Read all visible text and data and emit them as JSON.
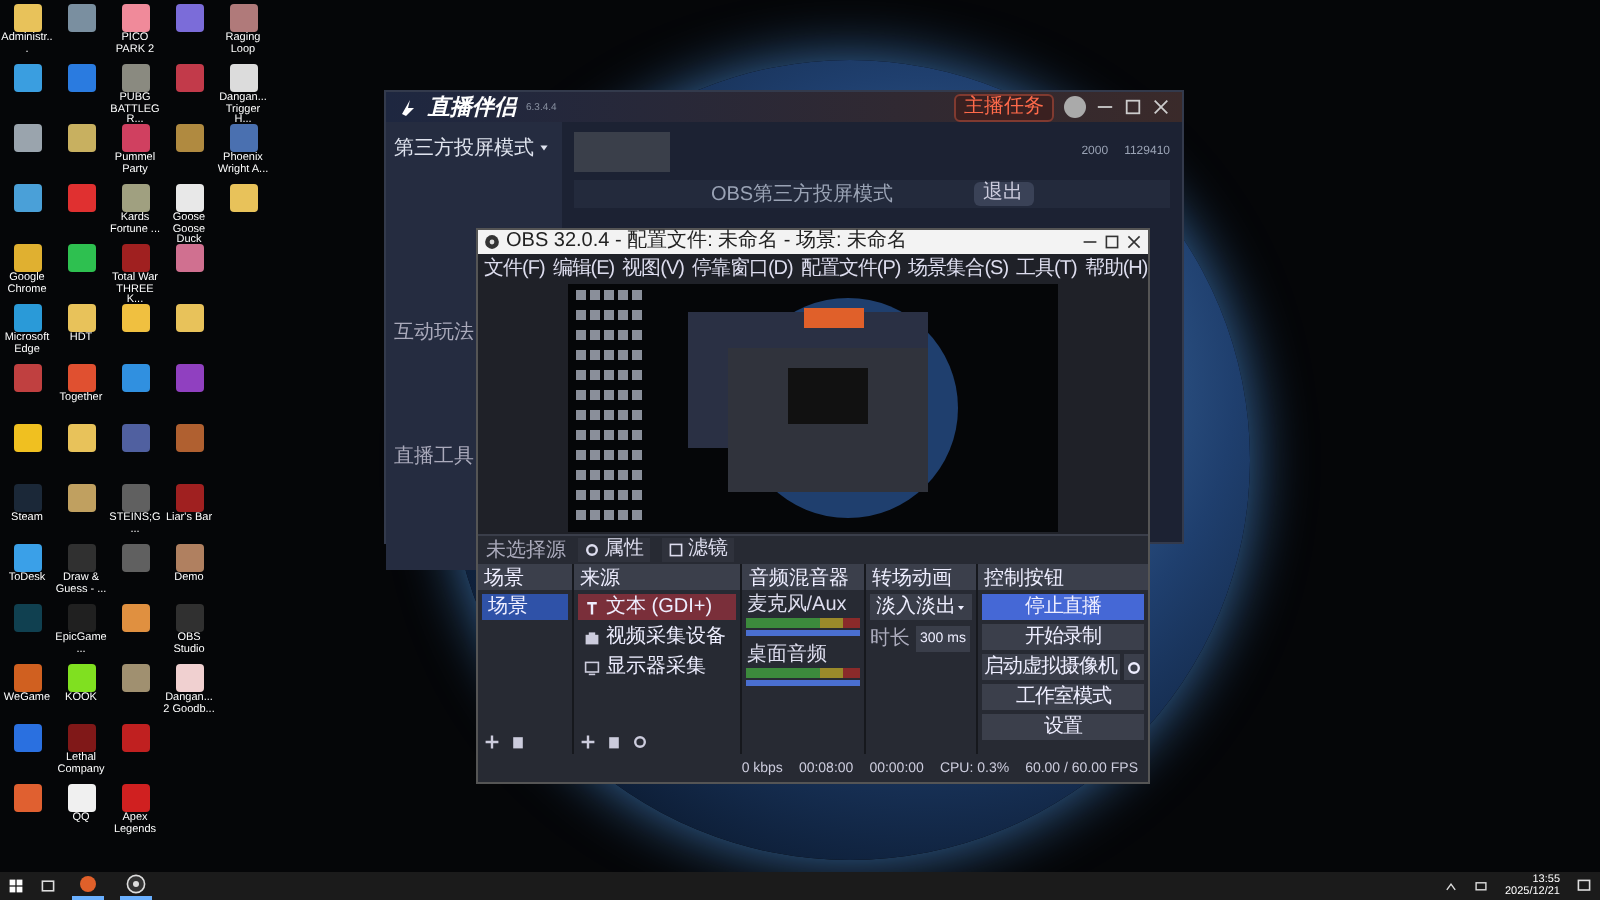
{
  "desktop": {
    "icon_rows": [
      [
        {
          "label": "Administr...",
          "color": "#e8c25a"
        },
        {
          "color": "#7a8fa0"
        },
        {
          "label": "PICO PARK 2",
          "color": "#f08a9a"
        },
        {
          "color": "#7b6cd9"
        },
        {
          "label": "Raging Loop",
          "color": "#b07a7a"
        }
      ],
      [
        {
          "color": "#3a9ee0"
        },
        {
          "color": "#2a7be0"
        },
        {
          "label": "PUBG BATTLEGR...",
          "color": "#8a8a80"
        },
        {
          "color": "#c23a4a"
        },
        {
          "label": "Dangan... Trigger H...",
          "color": "#dcdcdc"
        }
      ],
      [
        {
          "color": "#9aa4ad"
        },
        {
          "color": "#c8b060"
        },
        {
          "label": "Pummel Party",
          "color": "#d04060"
        },
        {
          "color": "#b08a40"
        },
        {
          "label": "Phoenix Wright A...",
          "color": "#4a70b0"
        }
      ],
      [
        {
          "color": "#4aa0d8"
        },
        {
          "color": "#e03030"
        },
        {
          "label": "Kards Fortune ...",
          "color": "#a0a080"
        },
        {
          "label": "Goose Goose Duck",
          "color": "#e8e8e8"
        },
        {
          "color": "#e8c25a"
        }
      ],
      [
        {
          "label": "Google Chrome",
          "color": "#e0b030"
        },
        {
          "color": "#2ec050"
        },
        {
          "label": "Total War THREE K...",
          "color": "#a02020"
        },
        {
          "color": "#d07090"
        }
      ],
      [
        {
          "label": "Microsoft Edge",
          "color": "#2a9ad8"
        },
        {
          "label": "HDT",
          "color": "#e8c25a"
        },
        {
          "color": "#f0c040"
        },
        {
          "color": "#e8c25a"
        }
      ],
      [
        {
          "color": "#c04040"
        },
        {
          "label": "Together",
          "color": "#e05030"
        },
        {
          "color": "#3090e0"
        },
        {
          "color": "#9040c0"
        }
      ],
      [
        {
          "color": "#f0c020"
        },
        {
          "color": "#e8c25a"
        },
        {
          "color": "#5060a0"
        },
        {
          "color": "#b06030"
        }
      ],
      [
        {
          "label": "Steam",
          "color": "#1b2838"
        },
        {
          "color": "#c0a060"
        },
        {
          "label": "STEINS;G...",
          "color": "#606060"
        },
        {
          "label": "Liar's Bar",
          "color": "#a02020"
        }
      ],
      [
        {
          "label": "ToDesk",
          "color": "#3aa0e8"
        },
        {
          "label": "Draw & Guess - ...",
          "color": "#303030"
        },
        {
          "color": "#606060"
        },
        {
          "label": "Demo",
          "color": "#b08060"
        }
      ],
      [
        {
          "color": "#104050"
        },
        {
          "label": "EpicGame...",
          "color": "#202020"
        },
        {
          "color": "#e09040"
        },
        {
          "label": "OBS Studio",
          "color": "#303030"
        }
      ],
      [
        {
          "label": "WeGame",
          "color": "#d06020"
        },
        {
          "label": "KOOK",
          "color": "#80e020"
        },
        {
          "color": "#a09070"
        },
        {
          "label": "Dangan... 2 Goodb...",
          "color": "#f0d0d0"
        }
      ],
      [
        {
          "color": "#2a70e0"
        },
        {
          "label": "Lethal Company",
          "color": "#801818"
        },
        {
          "color": "#c02020"
        }
      ],
      [
        {
          "color": "#e06030"
        },
        {
          "label": "QQ",
          "color": "#f0f0f0"
        },
        {
          "label": "Apex Legends",
          "color": "#d02020"
        }
      ]
    ]
  },
  "stream_app": {
    "title": "直播伴侣",
    "version": "6.3.4.4",
    "task_button": "主播任务",
    "mode": "第三方投屏模式",
    "sidebar_sections": [
      "互动玩法",
      "直播工具"
    ],
    "stats": [
      "2000",
      "1129410"
    ],
    "notice": "OBS第三方投屏模式",
    "exit_button": "退出"
  },
  "obs": {
    "title": "OBS 32.0.4 - 配置文件: 未命名 - 场景: 未命名",
    "menu": [
      "文件(F)",
      "编辑(E)",
      "视图(V)",
      "停靠窗口(D)",
      "配置文件(P)",
      "场景集合(S)",
      "工具(T)",
      "帮助(H)"
    ],
    "source_bar": {
      "label": "未选择源",
      "buttons": [
        "属性",
        "滤镜"
      ]
    },
    "scenes": {
      "title": "场景",
      "items": [
        {
          "name": "场景",
          "selected": true
        }
      ]
    },
    "sources": {
      "title": "来源",
      "items": [
        {
          "name": "文本 (GDI+)",
          "kind": "text",
          "selected": true
        },
        {
          "name": "视频采集设备",
          "kind": "camera",
          "selected": false
        },
        {
          "name": "显示器采集",
          "kind": "display",
          "selected": false
        }
      ]
    },
    "mixer": {
      "title": "音频混音器",
      "channels": [
        {
          "name": "麦克风/Aux",
          "level": 1.0
        },
        {
          "name": "桌面音频",
          "level": 1.0
        }
      ]
    },
    "transitions": {
      "title": "转场动画",
      "type": "淡入淡出",
      "duration_label": "时长",
      "duration": "300 ms"
    },
    "controls": {
      "title": "控制按钮",
      "buttons": [
        {
          "label": "停止直播",
          "active": true
        },
        {
          "label": "开始录制",
          "active": false
        },
        {
          "label": "启动虚拟摄像机",
          "active": false
        },
        {
          "label": "工作室模式",
          "active": false
        },
        {
          "label": "设置",
          "active": false
        }
      ]
    },
    "status_bar": [
      "0 kbps",
      "00:08:00",
      "00:00:00",
      "CPU: 0.3%",
      "60.00 / 60.00 FPS"
    ]
  },
  "taskbar": {
    "apps": [
      {
        "kind": "stream",
        "active": true
      },
      {
        "kind": "obs",
        "active": true
      }
    ],
    "time": "13:55",
    "date": "2025/12/21"
  }
}
